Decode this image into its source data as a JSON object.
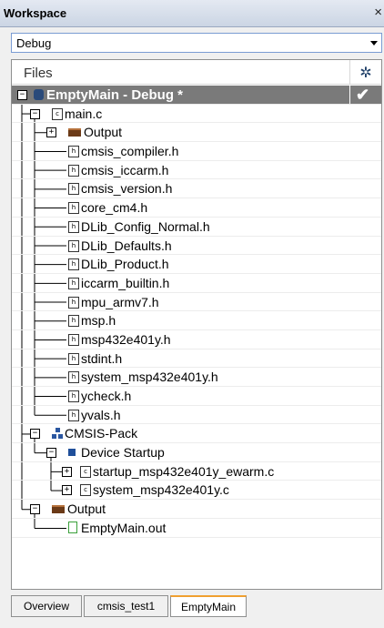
{
  "window": {
    "title": "Workspace",
    "close_glyph": "×"
  },
  "config": {
    "selected": "Debug"
  },
  "header": {
    "files_label": "Files",
    "options_icon": "gear-icon"
  },
  "tree": [
    {
      "label": "EmptyMain - Debug *",
      "depth": 0,
      "kind": "project",
      "expander": "-",
      "checked": true
    },
    {
      "label": "main.c",
      "depth": 1,
      "kind": "c-file",
      "expander": "-"
    },
    {
      "label": "Output",
      "depth": 2,
      "kind": "folder",
      "expander": "+"
    },
    {
      "label": "cmsis_compiler.h",
      "depth": 2,
      "kind": "h-file"
    },
    {
      "label": "cmsis_iccarm.h",
      "depth": 2,
      "kind": "h-file"
    },
    {
      "label": "cmsis_version.h",
      "depth": 2,
      "kind": "h-file"
    },
    {
      "label": "core_cm4.h",
      "depth": 2,
      "kind": "h-file"
    },
    {
      "label": "DLib_Config_Normal.h",
      "depth": 2,
      "kind": "h-file"
    },
    {
      "label": "DLib_Defaults.h",
      "depth": 2,
      "kind": "h-file"
    },
    {
      "label": "DLib_Product.h",
      "depth": 2,
      "kind": "h-file"
    },
    {
      "label": "iccarm_builtin.h",
      "depth": 2,
      "kind": "h-file"
    },
    {
      "label": "mpu_armv7.h",
      "depth": 2,
      "kind": "h-file"
    },
    {
      "label": "msp.h",
      "depth": 2,
      "kind": "h-file"
    },
    {
      "label": "msp432e401y.h",
      "depth": 2,
      "kind": "h-file"
    },
    {
      "label": "stdint.h",
      "depth": 2,
      "kind": "h-file"
    },
    {
      "label": "system_msp432e401y.h",
      "depth": 2,
      "kind": "h-file"
    },
    {
      "label": "ycheck.h",
      "depth": 2,
      "kind": "h-file"
    },
    {
      "label": "yvals.h",
      "depth": 2,
      "kind": "h-file"
    },
    {
      "label": "CMSIS-Pack",
      "depth": 1,
      "kind": "pack",
      "expander": "-"
    },
    {
      "label": "Device Startup",
      "depth": 2,
      "kind": "device",
      "expander": "-"
    },
    {
      "label": "startup_msp432e401y_ewarm.c",
      "depth": 3,
      "kind": "c-file",
      "expander": "+"
    },
    {
      "label": "system_msp432e401y.c",
      "depth": 3,
      "kind": "c-file",
      "expander": "+"
    },
    {
      "label": "Output",
      "depth": 1,
      "kind": "folder",
      "expander": "-"
    },
    {
      "label": "EmptyMain.out",
      "depth": 2,
      "kind": "out-file"
    }
  ],
  "tabs": [
    {
      "label": "Overview",
      "active": false
    },
    {
      "label": "cmsis_test1",
      "active": false
    },
    {
      "label": "EmptyMain",
      "active": true
    }
  ],
  "colors": {
    "root_row": "#7a7a7a",
    "active_tab_accent": "#f0a030",
    "folder": "#6b3a17"
  }
}
